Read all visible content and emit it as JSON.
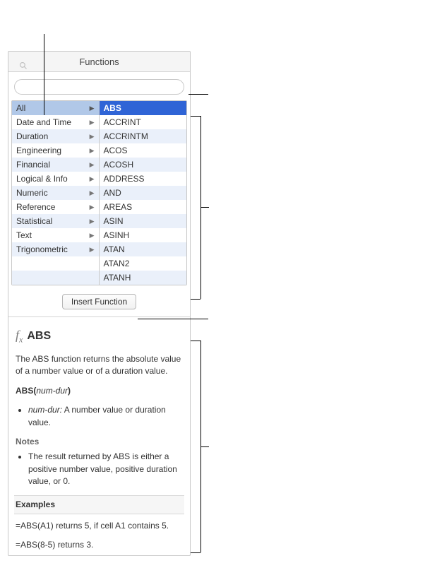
{
  "header": {
    "title": "Functions"
  },
  "search": {
    "value": "",
    "placeholder": ""
  },
  "categories": [
    {
      "label": "All",
      "selected": true
    },
    {
      "label": "Date and Time",
      "selected": false
    },
    {
      "label": "Duration",
      "selected": false
    },
    {
      "label": "Engineering",
      "selected": false
    },
    {
      "label": "Financial",
      "selected": false
    },
    {
      "label": "Logical & Info",
      "selected": false
    },
    {
      "label": "Numeric",
      "selected": false
    },
    {
      "label": "Reference",
      "selected": false
    },
    {
      "label": "Statistical",
      "selected": false
    },
    {
      "label": "Text",
      "selected": false
    },
    {
      "label": "Trigonometric",
      "selected": false
    }
  ],
  "functions": [
    {
      "label": "ABS",
      "selected": true
    },
    {
      "label": "ACCRINT",
      "selected": false
    },
    {
      "label": "ACCRINTM",
      "selected": false
    },
    {
      "label": "ACOS",
      "selected": false
    },
    {
      "label": "ACOSH",
      "selected": false
    },
    {
      "label": "ADDRESS",
      "selected": false
    },
    {
      "label": "AND",
      "selected": false
    },
    {
      "label": "AREAS",
      "selected": false
    },
    {
      "label": "ASIN",
      "selected": false
    },
    {
      "label": "ASINH",
      "selected": false
    },
    {
      "label": "ATAN",
      "selected": false
    },
    {
      "label": "ATAN2",
      "selected": false
    },
    {
      "label": "ATANH",
      "selected": false
    }
  ],
  "insert_button": "Insert Function",
  "help": {
    "fn_name": "ABS",
    "summary": "The ABS function returns the absolute value of a number value or of a duration value.",
    "syntax_fn": "ABS",
    "syntax_arg": "num-dur",
    "args": [
      {
        "name": "num-dur:",
        "desc": " A number value or duration value."
      }
    ],
    "notes_heading": "Notes",
    "notes": [
      "The result returned by ABS is either a positive number value, positive duration value, or 0."
    ],
    "examples_heading": "Examples",
    "examples": [
      "=ABS(A1) returns 5, if cell A1 contains 5.",
      "=ABS(8-5) returns 3."
    ]
  }
}
